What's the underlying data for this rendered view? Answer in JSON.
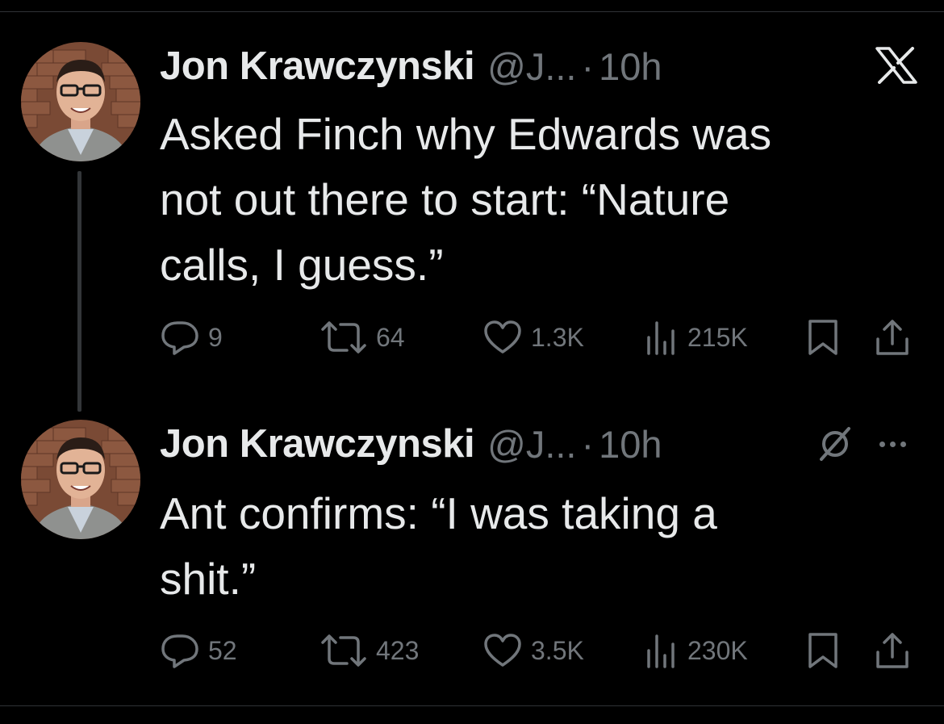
{
  "tweets": [
    {
      "author_name": "Jon Krawczynski",
      "handle": "@J...",
      "separator": "·",
      "time": "10h",
      "text": "Asked Finch why Edwards was\nnot out there to start: “Nature\ncalls, I guess.”",
      "replies": "9",
      "reposts": "64",
      "likes": "1.3K",
      "views": "215K",
      "corner_icon": "x-logo-icon"
    },
    {
      "author_name": "Jon Krawczynski",
      "handle": "@J...",
      "separator": "·",
      "time": "10h",
      "text": "Ant confirms: “I was taking a\nshit.”",
      "replies": "52",
      "reposts": "423",
      "likes": "3.5K",
      "views": "230K",
      "corner_icons": [
        "grok-slash-icon",
        "more-icon"
      ]
    }
  ],
  "icons": {
    "reply": "reply-icon",
    "repost": "repost-icon",
    "like": "heart-icon",
    "views": "views-chart-icon",
    "bookmark": "bookmark-icon",
    "share": "share-icon"
  },
  "colors": {
    "background": "#000000",
    "text_primary": "#e7e9ea",
    "text_secondary": "#71767b",
    "divider": "#2f3336"
  }
}
